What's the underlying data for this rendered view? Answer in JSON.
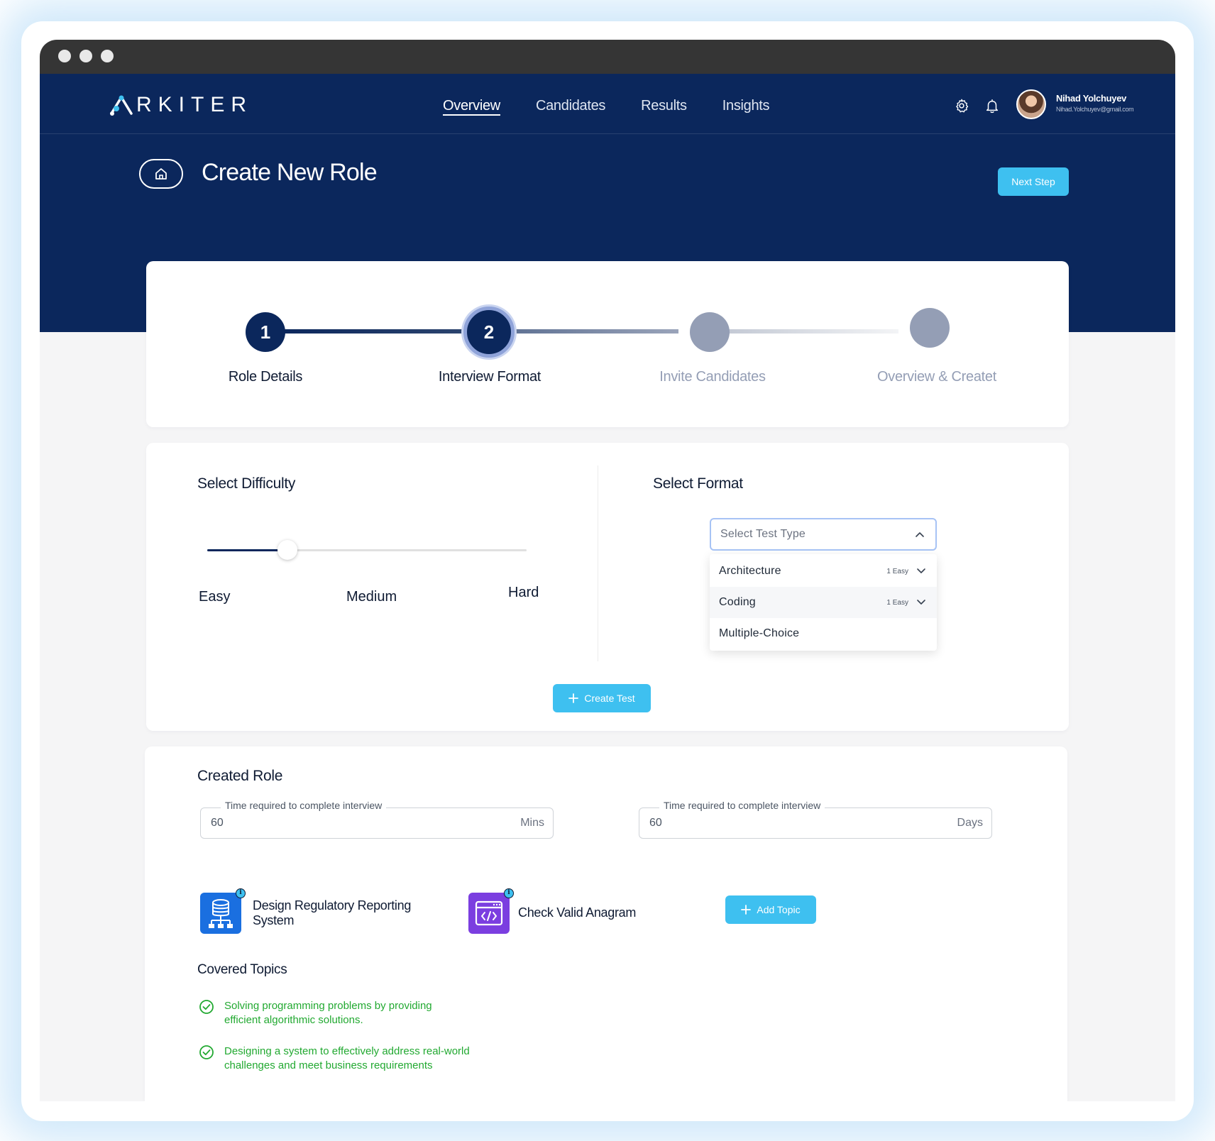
{
  "app": {
    "logo_text": "RKITER"
  },
  "nav": {
    "links": [
      {
        "label": "Overview",
        "active": true
      },
      {
        "label": "Candidates",
        "active": false
      },
      {
        "label": "Results",
        "active": false
      },
      {
        "label": "Insights",
        "active": false
      }
    ]
  },
  "user": {
    "name": "Nihad Yolchuyev",
    "email": "Nihad.Yolchuyev@gmail.com"
  },
  "page": {
    "title": "Create New Role",
    "next_label": "Next Step"
  },
  "stepper": {
    "steps": [
      {
        "number": "1",
        "label": "Role Details",
        "state": "done"
      },
      {
        "number": "2",
        "label": "Interview Format",
        "state": "current"
      },
      {
        "number": "",
        "label": "Invite Candidates",
        "state": "upcoming"
      },
      {
        "number": "",
        "label": "Overview & Createt",
        "state": "upcoming"
      }
    ]
  },
  "difficulty": {
    "title": "Select Difficulty",
    "levels": [
      "Easy",
      "Medium",
      "Hard"
    ],
    "value_fraction": 0.25
  },
  "format": {
    "title": "Select Format",
    "placeholder": "Select Test Type",
    "options": [
      {
        "label": "Architecture",
        "badge": "1 Easy"
      },
      {
        "label": "Coding",
        "badge": "1 Easy"
      },
      {
        "label": "Multiple-Choice",
        "badge": ""
      }
    ],
    "create_label": "Create Test"
  },
  "created_role": {
    "title": "Created Role",
    "fields": [
      {
        "legend": "Time required to complete interview",
        "value": "60",
        "unit": "Mins"
      },
      {
        "legend": "Time required to complete interview",
        "value": "60",
        "unit": "Days"
      }
    ],
    "topics": [
      {
        "label_line1": "Design Regulatory Reporting",
        "label_line2": "System",
        "icon": "database-network-icon"
      },
      {
        "label_line1": "Check Valid Anagram",
        "label_line2": "",
        "icon": "code-window-icon"
      }
    ],
    "add_topic_label": "Add Topic",
    "covered_title": "Covered Topics",
    "covered": [
      {
        "line1": "Solving programming problems by providing",
        "line2": "efficient algorithmic solutions."
      },
      {
        "line1": "Designing a system to effectively address real-world",
        "line2": "challenges and meet business requirements"
      }
    ]
  },
  "colors": {
    "navy": "#0b275c",
    "accent": "#3ec0f0",
    "success": "#22a931",
    "upcoming": "#949eb5"
  }
}
